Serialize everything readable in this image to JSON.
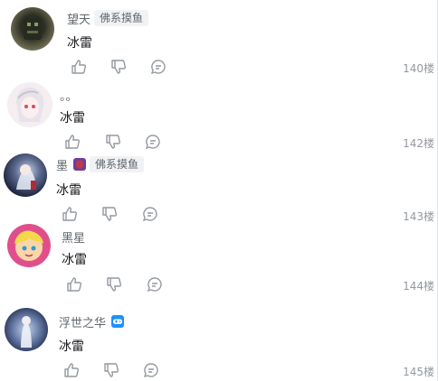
{
  "comments": [
    {
      "user": "望天",
      "badge": "佛系摸鱼",
      "content": "冰雷",
      "floor": "140楼"
    },
    {
      "user": "。。",
      "badge": "",
      "content": "冰雷",
      "floor": "142楼"
    },
    {
      "user": "墨",
      "badge": "佛系摸鱼",
      "content": "冰雷",
      "floor": "143楼"
    },
    {
      "user": "黑星",
      "badge": "",
      "content": "冰雷",
      "floor": "144楼"
    },
    {
      "user": "浮世之华",
      "badge": "",
      "content": "冰雷",
      "floor": "145楼"
    }
  ],
  "icons": {
    "like": "thumbs-up-icon",
    "dislike": "thumbs-down-icon",
    "reply": "reply-bubble-icon"
  },
  "colors": {
    "text": "#18191c",
    "muted": "#61666d",
    "floor": "#9499a0",
    "icon": "#9499a0",
    "badge_bg": "#f1f2f3",
    "medal_blue": "#1e90ff",
    "medal_purple": "#6b3fa0"
  }
}
